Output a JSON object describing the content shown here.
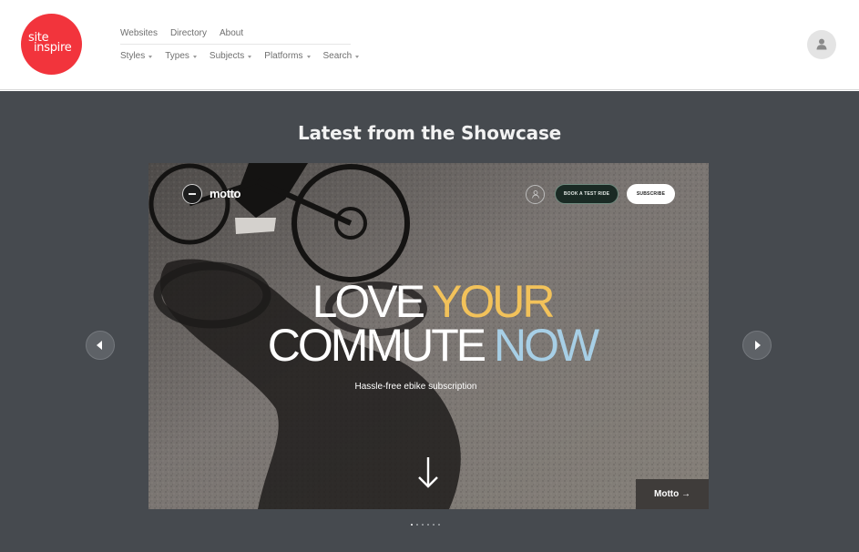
{
  "header": {
    "logo": {
      "line1": "site",
      "line2": "inspire",
      "color": "#f2343c"
    },
    "nav_top": [
      "Websites",
      "Directory",
      "About"
    ],
    "nav_dropdowns": [
      "Styles",
      "Types",
      "Subjects",
      "Platforms",
      "Search"
    ],
    "user_icon": "user-icon"
  },
  "showcase": {
    "title": "Latest from the Showcase",
    "prev_icon": "chevron-left-icon",
    "next_icon": "chevron-right-icon",
    "slide": {
      "brand": "motto",
      "buttons": {
        "test_ride": "BOOK A TEST RIDE",
        "subscribe": "SUBSCRIBE"
      },
      "headline": {
        "word1": "LOVE",
        "word2": "YOUR",
        "word3": "COMMUTE",
        "word4": "NOW"
      },
      "subtitle": "Hassle-free ebike subscription",
      "site_link": "Motto →",
      "colors": {
        "yellow": "#f2c25a",
        "blue": "#a7cfe6"
      }
    },
    "dots": {
      "count": 6,
      "active_index": 0
    }
  }
}
